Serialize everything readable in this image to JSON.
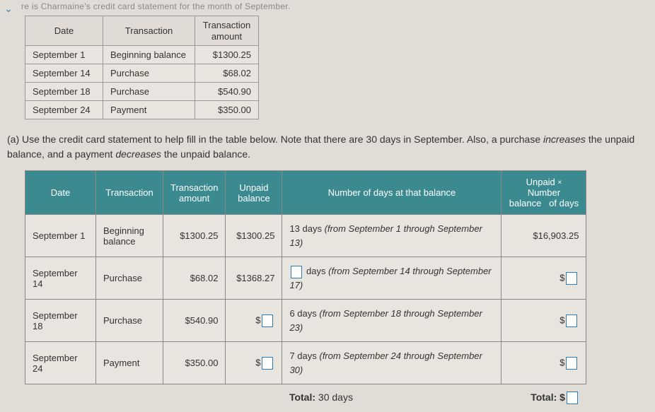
{
  "top_text": "re is Charmaine's credit card statement for the month of September.",
  "statement": {
    "headers": [
      "Date",
      "Transaction",
      "Transaction amount"
    ],
    "rows": [
      {
        "date": "September 1",
        "trans": "Beginning balance",
        "amt": "$1300.25"
      },
      {
        "date": "September 14",
        "trans": "Purchase",
        "amt": "$68.02"
      },
      {
        "date": "September 18",
        "trans": "Purchase",
        "amt": "$540.90"
      },
      {
        "date": "September 24",
        "trans": "Payment",
        "amt": "$350.00"
      }
    ]
  },
  "question": {
    "label": "(a)",
    "text1": "Use the credit card statement to help fill in the table below. Note that there are ",
    "thirty": "30",
    "text2": " days in September. Also, a purchase ",
    "inc": "increases",
    "text3": " the unpaid balance, and a payment ",
    "dec": "decreases",
    "text4": " the unpaid balance."
  },
  "main": {
    "headers": {
      "date": "Date",
      "trans": "Transaction",
      "amt_l1": "Transaction",
      "amt_l2": "amount",
      "bal_l1": "Unpaid",
      "bal_l2": "balance",
      "days": "Number of days at that balance",
      "prod_l1": "Unpaid",
      "prod_x": "×",
      "prod_l2": "Number",
      "prod_l3": "balance",
      "prod_l4": "of days"
    },
    "rows": [
      {
        "date": "September 1",
        "trans": "Beginning balance",
        "amt": "$1300.25",
        "bal": "$1300.25",
        "days_num": "13",
        "days_text": " days ",
        "days_paren": "(from September 1 through September 13)",
        "prod": "$16,903.25",
        "bal_input": false,
        "days_input": false,
        "prod_input": false
      },
      {
        "date": "September 14",
        "trans": "Purchase",
        "amt": "$68.02",
        "bal": "$1368.27",
        "days_text": " days ",
        "days_paren": "(from September 14 through September 17)",
        "bal_input": false,
        "days_input": true,
        "prod_input": true
      },
      {
        "date": "September 18",
        "trans": "Purchase",
        "amt": "$540.90",
        "days_num": "6",
        "days_text": " days ",
        "days_paren": "(from September 18 through September 23)",
        "bal_input": true,
        "days_input": false,
        "prod_input": true
      },
      {
        "date": "September 24",
        "trans": "Payment",
        "amt": "$350.00",
        "days_num": "7",
        "days_text": " days ",
        "days_paren": "(from September 24 through September 30)",
        "bal_input": true,
        "days_input": false,
        "prod_input": true
      }
    ],
    "total_days_label": "Total:",
    "total_days": " 30 days",
    "total_label": "Total:  $"
  }
}
